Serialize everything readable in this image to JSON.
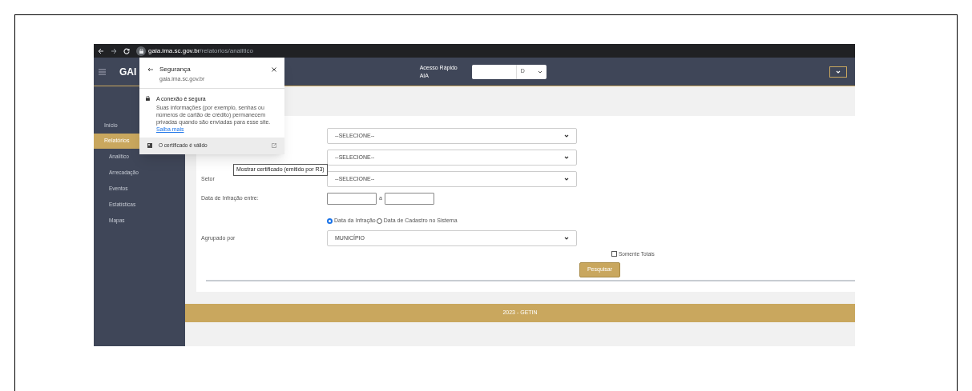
{
  "browser": {
    "url_host": "gaia.ima.sc.gov.br",
    "url_path": "/relatorios/analitico"
  },
  "header": {
    "logo": "GAI",
    "quick_access_label": "Acesso Rápido AIA",
    "quick_access_value": "D"
  },
  "sidebar": {
    "items": [
      {
        "label": "Início",
        "kind": "section",
        "selected": false
      },
      {
        "label": "Relatórios",
        "kind": "section",
        "selected": true
      },
      {
        "label": "Analítico",
        "kind": "sub",
        "selected": false
      },
      {
        "label": "Arrecadação",
        "kind": "sub",
        "selected": false
      },
      {
        "label": "Eventos",
        "kind": "sub",
        "selected": false
      },
      {
        "label": "Estatísticas",
        "kind": "sub",
        "selected": false
      },
      {
        "label": "Mapas",
        "kind": "sub",
        "selected": false
      }
    ]
  },
  "form": {
    "rows": [
      {
        "kind": "select",
        "value": "--SELECIONE--"
      },
      {
        "kind": "select",
        "value": "--SELECIONE--"
      },
      {
        "kind": "select",
        "label": "Setor",
        "value": "--SELECIONE--"
      },
      {
        "kind": "date_range",
        "label": "Data de Infração entre:",
        "separator": "a"
      },
      {
        "kind": "radio",
        "options": [
          {
            "label": "Data da Infração",
            "selected": true
          },
          {
            "label": "Data de Cadastro no Sistema",
            "selected": false
          }
        ]
      },
      {
        "kind": "select",
        "label": "Agrupado por",
        "value": "MUNICÍPIO"
      }
    ],
    "checkbox": {
      "label": "Somente Totais",
      "checked": false
    },
    "button": "Pesquisar"
  },
  "footer": "2023 - GETIN",
  "security_popup": {
    "title": "Segurança",
    "host": "gaia.ima.sc.gov.br",
    "heading": "A conexão é segura",
    "body": "Suas informações (por exemplo, senhas ou números de cartão de crédito) permanecem privadas quando são enviadas para esse site.",
    "link": "Saiba mais",
    "certificate": "O certificado é válido",
    "tooltip": "Mostrar certificado (emitido por R3)"
  }
}
